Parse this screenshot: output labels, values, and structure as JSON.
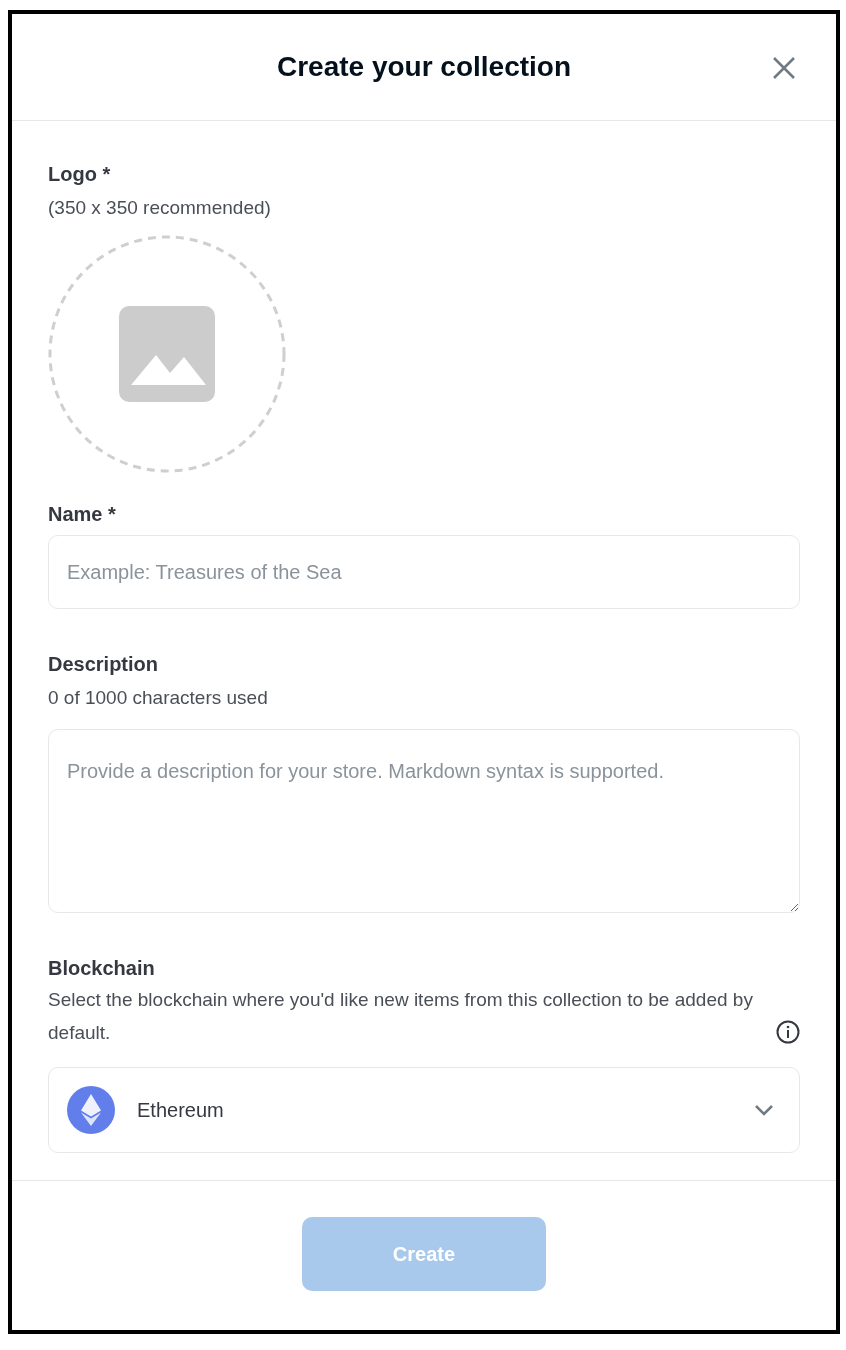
{
  "dialog": {
    "title": "Create your collection"
  },
  "logo": {
    "label": "Logo *",
    "hint": "(350 x 350 recommended)"
  },
  "name": {
    "label": "Name *",
    "placeholder": "Example: Treasures of the Sea"
  },
  "description": {
    "label": "Description",
    "counter": "0 of 1000 characters used",
    "placeholder": "Provide a description for your store. Markdown syntax is supported."
  },
  "blockchain": {
    "label": "Blockchain",
    "help": "Select the blockchain where you'd like new items from this collection to be added by default.",
    "value": "Ethereum"
  },
  "create_button": {
    "label": "Create",
    "disabled": true
  }
}
